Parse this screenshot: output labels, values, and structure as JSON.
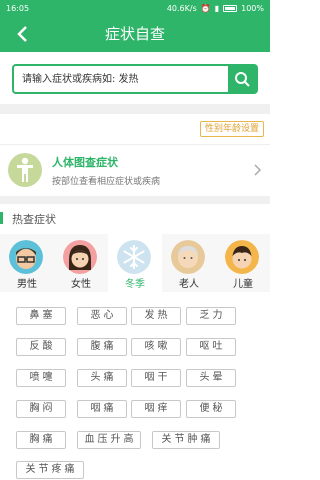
{
  "status": {
    "time": "16:05",
    "network": "40.6K/s",
    "battery": "100%"
  },
  "nav": {
    "title": "症状自查"
  },
  "search": {
    "placeholder": "请输入症状或疾病如: 发热"
  },
  "settings_label": "性别年龄设置",
  "body_map": {
    "title": "人体图查症状",
    "subtitle": "按部位查看相应症状或疾病"
  },
  "hot": {
    "title": "热查症状",
    "categories": [
      {
        "label": "男性",
        "icon": "male-avatar-icon"
      },
      {
        "label": "女性",
        "icon": "female-avatar-icon"
      },
      {
        "label": "冬季",
        "icon": "snowflake-icon",
        "selected": true
      },
      {
        "label": "老人",
        "icon": "elderly-avatar-icon"
      },
      {
        "label": "儿童",
        "icon": "child-avatar-icon"
      }
    ],
    "tags": [
      "鼻塞",
      "恶心",
      "发热",
      "乏力",
      "反酸",
      "腹痛",
      "咳嗽",
      "呕吐",
      "喷嚏",
      "头痛",
      "咽干",
      "头晕",
      "胸闷",
      "咽痛",
      "咽痒",
      "便秘",
      "胸痛",
      "血压升高",
      "关节肿痛",
      "关节疼痛"
    ]
  },
  "colors": {
    "primary": "#2fb56a",
    "accent_orange": "#e0a030"
  }
}
